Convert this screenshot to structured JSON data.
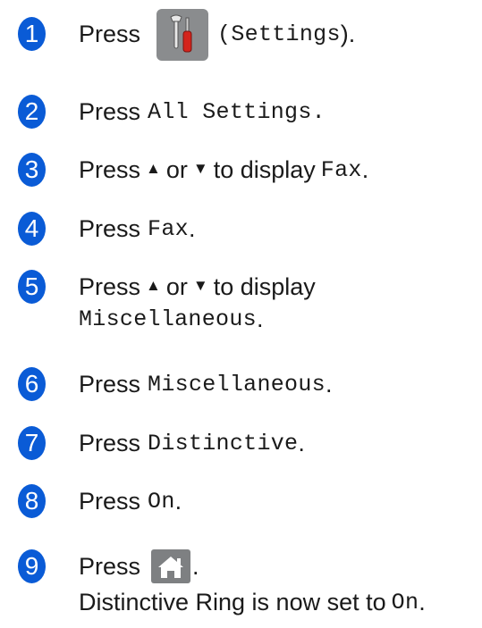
{
  "colors": {
    "step_circle": "#0a5bd6",
    "settings_icon_bg": "#8a8c8e",
    "home_icon_bg": "#7e8082",
    "text": "#1a1a1a"
  },
  "steps": [
    {
      "n": "1",
      "press": "Press",
      "open_paren": "(",
      "code": "Settings",
      "close": ").",
      "icon": "settings-icon"
    },
    {
      "n": "2",
      "press": "Press",
      "code": "All Settings",
      "end": "."
    },
    {
      "n": "3",
      "press": "Press",
      "up": "▲",
      "or": "or",
      "down": "▼",
      "to_display": "to display",
      "code": "Fax",
      "end": "."
    },
    {
      "n": "4",
      "press": "Press",
      "code": "Fax",
      "end": "."
    },
    {
      "n": "5",
      "press": "Press",
      "up": "▲",
      "or": "or",
      "down": "▼",
      "to_display": "to display",
      "code": "Miscellaneous",
      "end": "."
    },
    {
      "n": "6",
      "press": "Press",
      "code": "Miscellaneous",
      "end": "."
    },
    {
      "n": "7",
      "press": "Press",
      "code": "Distinctive",
      "end": "."
    },
    {
      "n": "8",
      "press": "Press",
      "code": "On",
      "end": "."
    },
    {
      "n": "9",
      "press": "Press",
      "end": ".",
      "icon": "home-icon",
      "result_text": "Distinctive Ring is now set to",
      "result_code": "On",
      "result_end": "."
    }
  ]
}
